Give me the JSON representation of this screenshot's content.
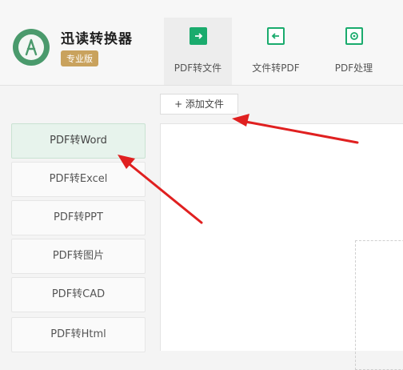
{
  "app": {
    "title": "迅读转换器",
    "edition_badge": "专业版"
  },
  "tabs": [
    {
      "label": "PDF转文件",
      "active": true
    },
    {
      "label": "文件转PDF",
      "active": false
    },
    {
      "label": "PDF处理",
      "active": false
    }
  ],
  "toolbar": {
    "add_file_label": "+ 添加文件"
  },
  "sidebar": {
    "items": [
      {
        "label": "PDF转Word",
        "active": true
      },
      {
        "label": "PDF转Excel",
        "active": false
      },
      {
        "label": "PDF转PPT",
        "active": false
      },
      {
        "label": "PDF转图片",
        "active": false
      },
      {
        "label": "PDF转CAD",
        "active": false
      },
      {
        "label": "PDF转Html",
        "active": false
      }
    ]
  },
  "colors": {
    "accent": "#1aab6d",
    "badge": "#c9a25d",
    "annotation_arrow": "#e02020"
  }
}
